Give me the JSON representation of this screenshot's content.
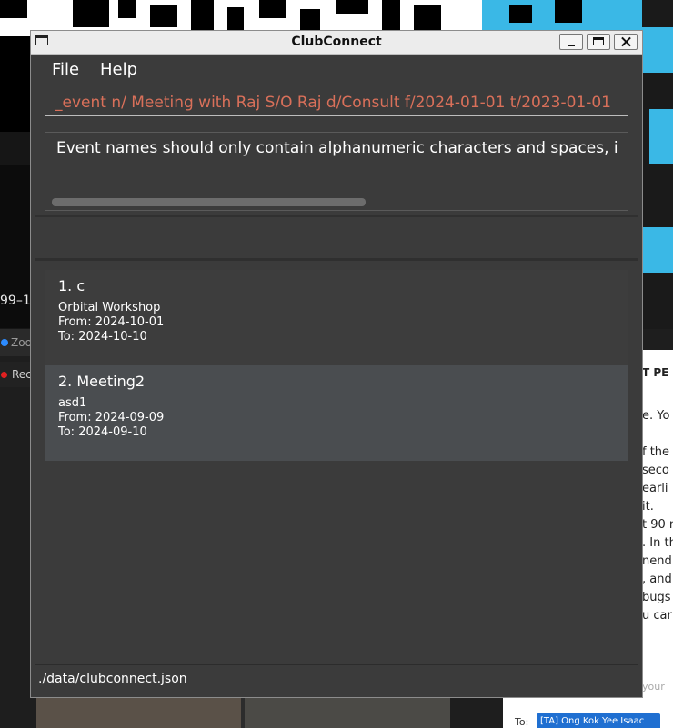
{
  "window": {
    "title": "ClubConnect"
  },
  "menu": {
    "file": "File",
    "help": "Help"
  },
  "command": {
    "value": "_event n/ Meeting with Raj S/O Raj d/Consult f/2024-01-01 t/2023-01-01"
  },
  "result": {
    "message": "Event names should only contain alphanumeric characters and spaces, i"
  },
  "events": [
    {
      "title": "1. c",
      "name": "Orbital Workshop",
      "from": "From: 2024-10-01",
      "to": "To: 2024-10-10"
    },
    {
      "title": "2. Meeting2",
      "name": "asd1",
      "from": "From: 2024-09-09",
      "to": "To: 2024-09-10"
    }
  ],
  "statusbar": {
    "path": "./data/clubconnect.json"
  },
  "background": {
    "left_number": "99–1",
    "zoom_label": "Zoo",
    "rec_label": "Rec",
    "doc_header": "T PE",
    "doc_lines": [
      "e. Yo",
      "f the",
      "seco",
      "earli",
      "it.",
      "t 90 n",
      ". In th",
      "nend",
      ", and",
      "bugs",
      "u car"
    ],
    "chat_input": "your",
    "to_label": "To:",
    "to_recipient": "[TA] Ong Kok Yee Isaac"
  },
  "colors": {
    "command_text": "#d9705a",
    "selected_card": "#4a4d50",
    "window_bg": "#3b3b3b"
  }
}
